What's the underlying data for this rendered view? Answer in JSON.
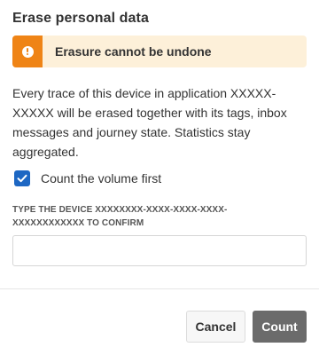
{
  "dialog": {
    "title": "Erase personal data",
    "alert": {
      "icon": "warning-icon",
      "text": "Erasure cannot be undone",
      "accent_color": "#ef8416",
      "background_color": "#fdf0d9"
    },
    "description": "Every trace of this device in application XXXXX-XXXXX will be erased together with its tags, inbox messages and journey state. Statistics stay aggregated.",
    "count_first": {
      "label": "Count the volume first",
      "checked": true,
      "color": "#1d67c3"
    },
    "confirm": {
      "label": "TYPE THE DEVICE XXXXXXXX-XXXX-XXXX-XXXX-XXXXXXXXXXXX TO CONFIRM",
      "value": "",
      "placeholder": ""
    },
    "buttons": {
      "cancel_label": "Cancel",
      "count_label": "Count"
    }
  }
}
